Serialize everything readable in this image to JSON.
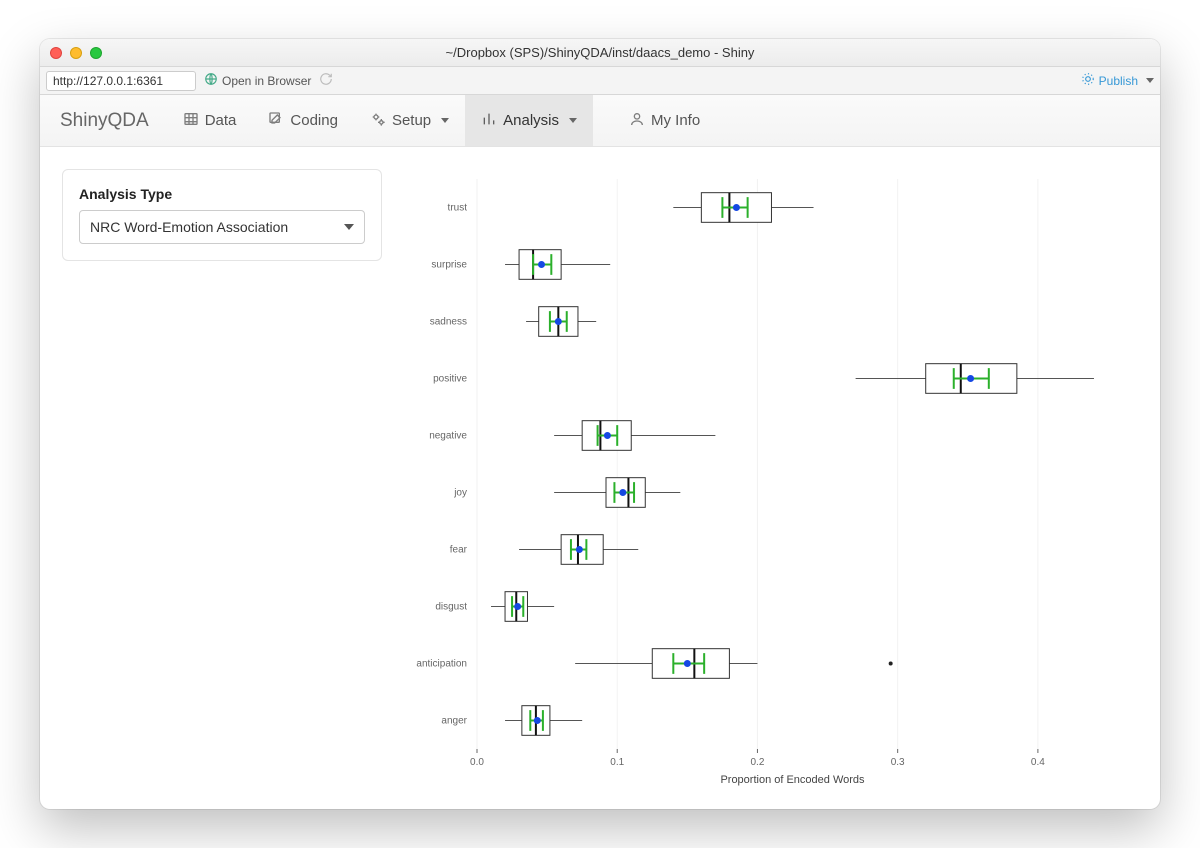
{
  "window": {
    "title": "~/Dropbox (SPS)/ShinyQDA/inst/daacs_demo - Shiny"
  },
  "toolbar": {
    "url": "http://127.0.0.1:6361",
    "open_in_browser": "Open in Browser",
    "publish": "Publish"
  },
  "nav": {
    "brand": "ShinyQDA",
    "items": [
      {
        "icon": "table",
        "label": "Data",
        "active": false,
        "dropdown": false
      },
      {
        "icon": "pencil-edit",
        "label": "Coding",
        "active": false,
        "dropdown": false
      },
      {
        "icon": "gears",
        "label": "Setup",
        "active": false,
        "dropdown": true
      },
      {
        "icon": "bar-chart",
        "label": "Analysis",
        "active": true,
        "dropdown": true
      },
      {
        "icon": "user",
        "label": "My Info",
        "active": false,
        "dropdown": false
      }
    ]
  },
  "sidebar": {
    "label": "Analysis Type",
    "selected": "NRC Word-Emotion Association"
  },
  "chart_data": {
    "type": "boxplot",
    "xlabel": "Proportion of Encoded Words",
    "ylabel": "",
    "xlim": [
      0.0,
      0.45
    ],
    "xticks": [
      0.0,
      0.1,
      0.2,
      0.3,
      0.4
    ],
    "categories": [
      "trust",
      "surprise",
      "sadness",
      "positive",
      "negative",
      "joy",
      "fear",
      "disgust",
      "anticipation",
      "anger"
    ],
    "series": [
      {
        "name": "trust",
        "q1": 0.16,
        "median": 0.18,
        "q3": 0.21,
        "low": 0.14,
        "high": 0.24,
        "mean": 0.185,
        "ci_lo": 0.175,
        "ci_hi": 0.193,
        "outliers": []
      },
      {
        "name": "surprise",
        "q1": 0.03,
        "median": 0.04,
        "q3": 0.06,
        "low": 0.02,
        "high": 0.095,
        "mean": 0.046,
        "ci_lo": 0.04,
        "ci_hi": 0.053,
        "outliers": []
      },
      {
        "name": "sadness",
        "q1": 0.044,
        "median": 0.058,
        "q3": 0.072,
        "low": 0.035,
        "high": 0.085,
        "mean": 0.058,
        "ci_lo": 0.052,
        "ci_hi": 0.064,
        "outliers": []
      },
      {
        "name": "positive",
        "q1": 0.32,
        "median": 0.345,
        "q3": 0.385,
        "low": 0.27,
        "high": 0.44,
        "mean": 0.352,
        "ci_lo": 0.34,
        "ci_hi": 0.365,
        "outliers": []
      },
      {
        "name": "negative",
        "q1": 0.075,
        "median": 0.088,
        "q3": 0.11,
        "low": 0.055,
        "high": 0.17,
        "mean": 0.093,
        "ci_lo": 0.086,
        "ci_hi": 0.1,
        "outliers": []
      },
      {
        "name": "joy",
        "q1": 0.092,
        "median": 0.108,
        "q3": 0.12,
        "low": 0.055,
        "high": 0.145,
        "mean": 0.104,
        "ci_lo": 0.098,
        "ci_hi": 0.112,
        "outliers": []
      },
      {
        "name": "fear",
        "q1": 0.06,
        "median": 0.072,
        "q3": 0.09,
        "low": 0.03,
        "high": 0.115,
        "mean": 0.073,
        "ci_lo": 0.067,
        "ci_hi": 0.078,
        "outliers": []
      },
      {
        "name": "disgust",
        "q1": 0.02,
        "median": 0.028,
        "q3": 0.036,
        "low": 0.01,
        "high": 0.055,
        "mean": 0.029,
        "ci_lo": 0.025,
        "ci_hi": 0.033,
        "outliers": []
      },
      {
        "name": "anticipation",
        "q1": 0.125,
        "median": 0.155,
        "q3": 0.18,
        "low": 0.07,
        "high": 0.2,
        "mean": 0.15,
        "ci_lo": 0.14,
        "ci_hi": 0.162,
        "outliers": [
          0.295
        ]
      },
      {
        "name": "anger",
        "q1": 0.032,
        "median": 0.042,
        "q3": 0.052,
        "low": 0.02,
        "high": 0.075,
        "mean": 0.043,
        "ci_lo": 0.038,
        "ci_hi": 0.047,
        "outliers": []
      }
    ]
  }
}
